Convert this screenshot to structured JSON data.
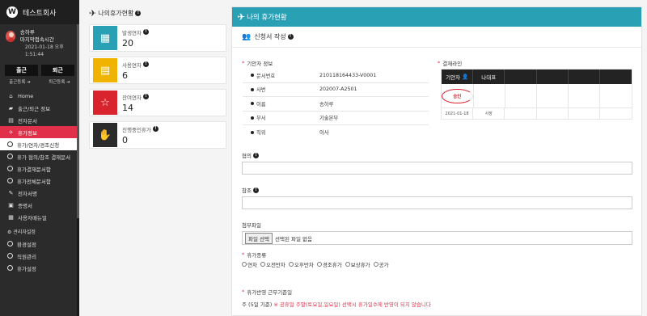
{
  "sidebar": {
    "brand_letter": "W",
    "brand_name": "테스트회사",
    "user_name": "송하루",
    "user_status": "마지막접속시간",
    "last_login": "2021-01-18 오후 1:51:44",
    "checkin_label": "출근",
    "checkout_label": "퇴근",
    "checkin_register": "출근등록",
    "checkout_register": "퇴근등록",
    "menu": [
      {
        "label": "Home",
        "icon": "home-icon"
      },
      {
        "label": "출근/퇴근 정보",
        "icon": "folder-icon"
      },
      {
        "label": "전자문서",
        "icon": "document-icon"
      },
      {
        "label": "휴가정보",
        "icon": "plane-icon"
      },
      {
        "label": "휴가/연차/경조신청"
      },
      {
        "label": "휴가 협의/참조 결재문서"
      },
      {
        "label": "휴가결재문서함"
      },
      {
        "label": "휴가전체문서함"
      },
      {
        "label": "전자서명",
        "icon": "pen-icon"
      },
      {
        "label": "증명서",
        "icon": "certificate-icon"
      },
      {
        "label": "사용자매뉴얼",
        "icon": "manual-icon"
      }
    ],
    "admin_section": "관리자설정",
    "admin_menu": [
      {
        "label": "환경설정"
      },
      {
        "label": "직원관리"
      },
      {
        "label": "휴가설정"
      }
    ]
  },
  "summary": {
    "title": "나의휴가현황",
    "cards": [
      {
        "label": "발생연차",
        "value": "20",
        "color": "#2aa0b5",
        "icon": "calendar-check-icon"
      },
      {
        "label": "사용연차",
        "value": "6",
        "color": "#f0b400",
        "icon": "presentation-icon"
      },
      {
        "label": "잔여연차",
        "value": "14",
        "color": "#d9232d",
        "icon": "star-icon"
      },
      {
        "label": "진행중인휴가",
        "value": "0",
        "color": "#2b2b2b",
        "icon": "handshake-icon"
      }
    ]
  },
  "main": {
    "header_title": "나의 휴가현황",
    "section_title": "신청서 작성",
    "applicant_title": "기안자 정보",
    "applicant": [
      {
        "key": "문서번호",
        "value": "210118164433-V0001"
      },
      {
        "key": "사번",
        "value": "202007-A2501"
      },
      {
        "key": "이름",
        "value": "송하루"
      },
      {
        "key": "부서",
        "value": "기술본부"
      },
      {
        "key": "직위",
        "value": "이사"
      }
    ],
    "approval_title": "결재라인",
    "approval": {
      "col1": "기안자",
      "col2": "나대표",
      "stamp_text": "승인",
      "date": "2021-01-18",
      "role": "사장"
    },
    "agreement_label": "협의",
    "reference_label": "참조",
    "attachment_label": "첨부파일",
    "file_button": "파일 선택",
    "file_status": "선택된 파일 없음",
    "leave_type_title": "휴가종류",
    "leave_types": [
      "연차",
      "오전반차",
      "오후반차",
      "경조휴가",
      "보상휴가",
      "공가"
    ],
    "criteria_title": "휴가반영 근무기준일",
    "criteria_prefix": "주 (5일 기준)",
    "criteria_warning": "※ 공휴일 주말(토요일,일요일) 선택시 휴가일수에 반영이 되지 않습니다"
  }
}
